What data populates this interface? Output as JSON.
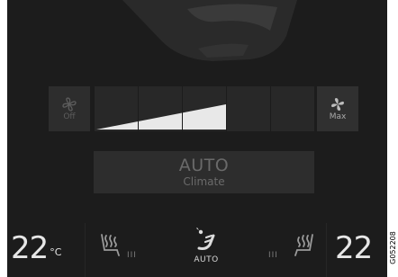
{
  "fan": {
    "off_label": "Off",
    "max_label": "Max",
    "level_fraction": 0.6
  },
  "auto_climate": {
    "title": "AUTO",
    "subtitle": "Climate"
  },
  "bottom_bar": {
    "left_temp_value": "22",
    "left_temp_unit": "°C",
    "right_temp_value": "22",
    "left_seat_heat_dots": "III",
    "right_seat_heat_dots": "III",
    "airflow_label": "AUTO"
  },
  "figure_code": "G052208",
  "colors": {
    "screen_bg": "#1c1c1c",
    "button_bg": "#2d2d2d",
    "active_text": "#e6e6e6",
    "dim_text": "#6a6a6a"
  }
}
